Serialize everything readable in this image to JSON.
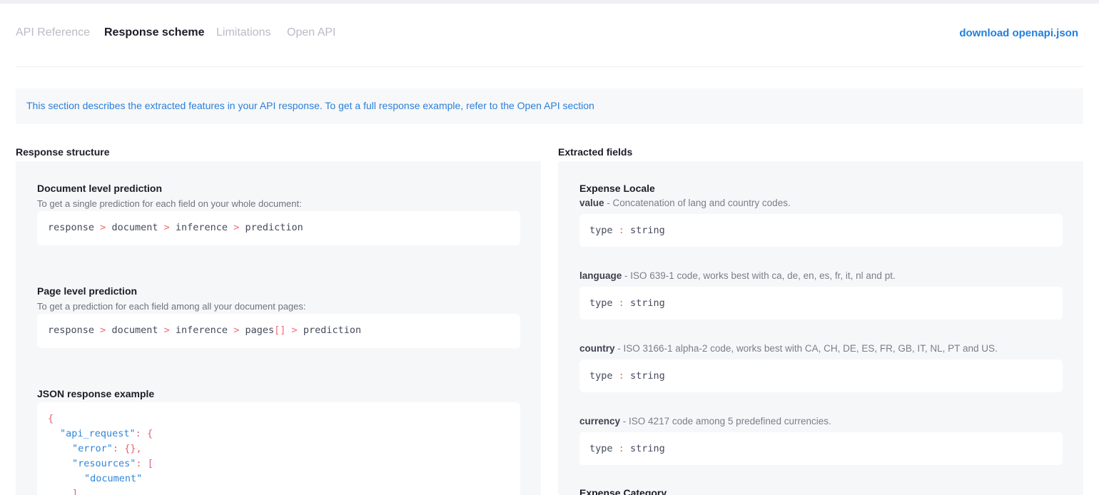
{
  "nav": {
    "tabs": [
      {
        "label": "API Reference",
        "active": false
      },
      {
        "label": "Response scheme",
        "active": true
      },
      {
        "label": "Limitations",
        "active": false
      },
      {
        "label": "Open API",
        "active": false
      }
    ],
    "download_label": "download openapi.json"
  },
  "info_text": "This section describes the extracted features in your API response. To get a full response example, refer to the Open API section",
  "left": {
    "title": "Response structure",
    "document_level": {
      "title": "Document level prediction",
      "desc": "To get a single prediction for each field on your whole document:",
      "path": [
        "response",
        "document",
        "inference",
        "prediction"
      ],
      "separator": ">"
    },
    "page_level": {
      "title": "Page level prediction",
      "desc": "To get a prediction for each field among all your document pages:",
      "path": [
        "response",
        "document",
        "inference",
        "pages",
        "prediction"
      ],
      "array_suffix": "[]",
      "separator": ">"
    },
    "json_example": {
      "title": "JSON response example",
      "open_brace": "{",
      "key_api_request": "\"api_request\"",
      "key_error": "\"error\"",
      "empty_object": "{},",
      "key_resources": "\"resources\"",
      "open_bracket": "[",
      "value_document": "\"document\"",
      "close_bracket": "],",
      "colon": ":"
    }
  },
  "right": {
    "title": "Extracted fields",
    "group_title": "Expense Locale",
    "group_title_next": "Expense Category",
    "type_label": "type",
    "type_colon": ":",
    "fields": [
      {
        "name": "value",
        "desc": " - Concatenation of lang and country codes.",
        "type": "string"
      },
      {
        "name": "language",
        "desc": " - ISO 639-1 code, works best with ca, de, en, es, fr, it, nl and pt.",
        "type": "string"
      },
      {
        "name": "country",
        "desc": " - ISO 3166-1 alpha-2 code, works best with CA, CH, DE, ES, FR, GB, IT, NL, PT and US.",
        "type": "string"
      },
      {
        "name": "currency",
        "desc": " - ISO 4217 code among 5 predefined currencies.",
        "type": "string"
      }
    ]
  },
  "colors": {
    "accent": "#1f80e0",
    "separator": "#ee6b75",
    "json_key": "#2f86d8",
    "panel_bg": "#f6f7f8"
  }
}
